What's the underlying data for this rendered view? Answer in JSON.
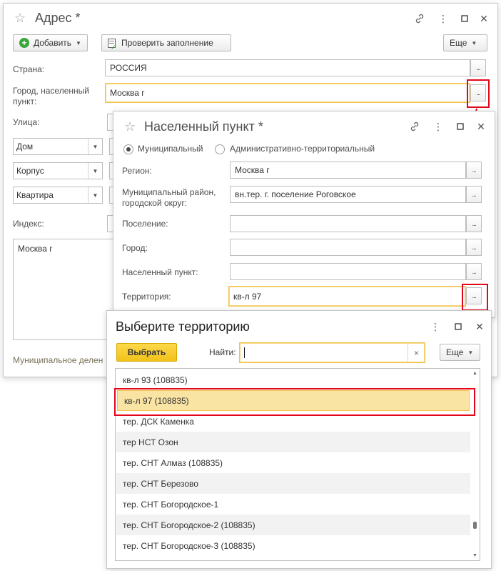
{
  "main_window": {
    "title": "Адрес *",
    "toolbar": {
      "add_label": "Добавить",
      "check_label": "Проверить заполнение",
      "more_label": "Еще"
    },
    "fields": {
      "country_label": "Страна:",
      "country_value": "РОССИЯ",
      "city_label": "Город, населенный пункт:",
      "city_value": "Москва г",
      "street_label": "Улица:",
      "house_type": "Дом",
      "building_type": "Корпус",
      "apartment_type": "Квартира",
      "index_label": "Индекс:",
      "address_text": "Москва г",
      "municipal_link": "Муниципальное делен"
    }
  },
  "locality_window": {
    "title": "Населенный пункт *",
    "radio_municipal": "Муниципальный",
    "radio_admin": "Административно-территориальный",
    "region_label": "Регион:",
    "region_value": "Москва г",
    "district_label": "Муниципальный район, городской округ:",
    "district_value": "вн.тер. г. поселение Роговское",
    "settlement_label": "Поселение:",
    "settlement_value": "",
    "city_label": "Город:",
    "city_value": "",
    "locality_label": "Населенный пункт:",
    "locality_value": "",
    "territory_label": "Территория:",
    "territory_value": "кв-л 97"
  },
  "territory_window": {
    "title": "Выберите территорию",
    "select_label": "Выбрать",
    "find_label": "Найти:",
    "find_value": "",
    "clear_symbol": "×",
    "more_label": "Еще",
    "items": [
      "кв-л 93 (108835)",
      "кв-л 97 (108835)",
      "тер. ДСК Каменка",
      "тер НСТ Озон",
      "тер. СНТ Алмаз (108835)",
      "тер. СНТ Березово",
      "тер. СНТ Богородское-1",
      "тер. СНТ Богородское-2 (108835)",
      "тер. СНТ Богородское-3 (108835)"
    ]
  },
  "icons": {
    "star": "☆",
    "link": "🔗",
    "menu": "⋮",
    "maximize": "□",
    "close": "✕",
    "dots": "..."
  },
  "colors": {
    "accent_yellow": "#f2c44e",
    "highlight_red": "#e3061b",
    "select_button": "#f5cd2a",
    "selected_row": "#fae4a4"
  }
}
